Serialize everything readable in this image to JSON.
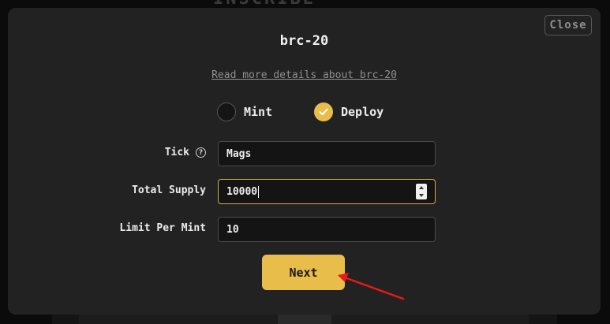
{
  "background": {
    "title": "INSCRIBE"
  },
  "modal": {
    "close_label": "Close",
    "title": "brc-20",
    "details_link": "Read more details about brc-20",
    "options": {
      "mint_label": "Mint",
      "deploy_label": "Deploy",
      "selected": "Deploy"
    },
    "fields": {
      "tick": {
        "label": "Tick",
        "value": "Mags"
      },
      "total_supply": {
        "label": "Total Supply",
        "value": "10000"
      },
      "limit_per_mint": {
        "label": "Limit Per Mint",
        "value": "10"
      }
    },
    "next_label": "Next"
  },
  "colors": {
    "accent": "#e9bd4a",
    "modal_bg": "#222222",
    "annotation_arrow": "#e8191c"
  },
  "icons": {
    "help": "question-circle-icon",
    "check": "check-icon"
  }
}
